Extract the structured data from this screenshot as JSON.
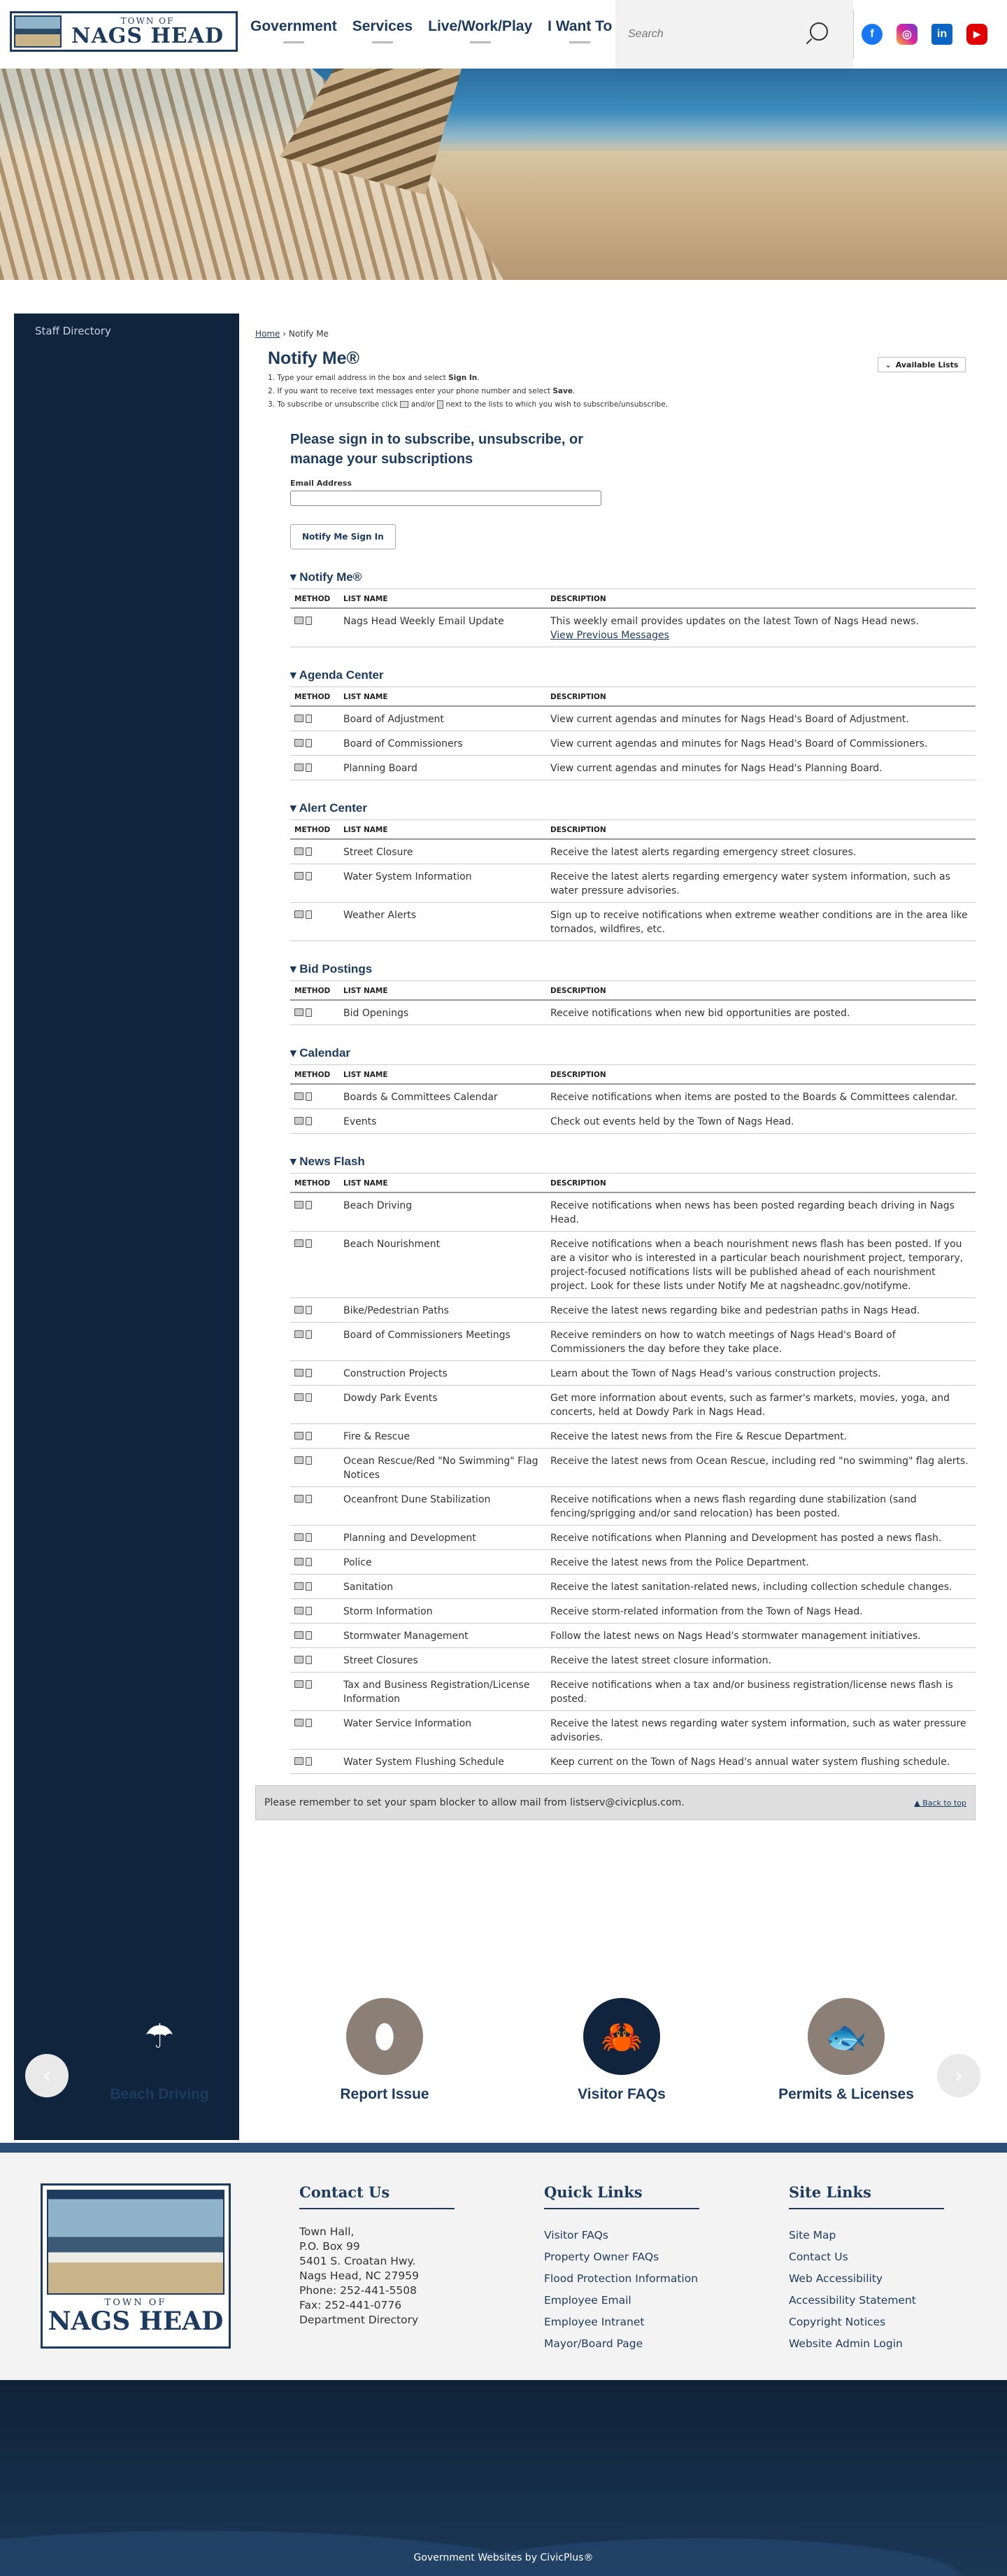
{
  "header": {
    "logo": {
      "top": "TOWN OF",
      "name": "NAGS HEAD"
    },
    "nav": [
      "Government",
      "Services",
      "Live/Work/Play",
      "I Want To"
    ],
    "search": {
      "placeholder": "Search",
      "value": ""
    },
    "social": [
      {
        "name": "facebook",
        "glyph": "f",
        "color": "#1877f2"
      },
      {
        "name": "instagram",
        "glyph": "◎",
        "color": "#d6249f"
      },
      {
        "name": "linkedin",
        "glyph": "in",
        "color": "#0a66c2"
      },
      {
        "name": "youtube",
        "glyph": "▶",
        "color": "#e00000"
      }
    ]
  },
  "sidebar": {
    "items": [
      "Staff Directory"
    ]
  },
  "breadcrumb": {
    "home": "Home",
    "sep": "›",
    "current": "Notify Me"
  },
  "page": {
    "title": "Notify Me®",
    "available_lists": "Available Lists",
    "instructions": [
      "1. Type your email address in the box and select ",
      "Sign In",
      "2. If you want to receive text messages enter your phone number and select ",
      "Save",
      "3. To subscribe or unsubscribe click ",
      " and/or ",
      " next to the lists to which you wish to subscribe/unsubscribe."
    ]
  },
  "signin": {
    "heading": "Please sign in to subscribe, unsubscribe, or manage your subscriptions",
    "email_label": "Email Address",
    "email_value": "",
    "button": "Notify Me Sign In"
  },
  "table_headers": {
    "method": "METHOD",
    "list": "LIST NAME",
    "desc": "DESCRIPTION"
  },
  "sections": [
    {
      "title": "Notify Me®",
      "rows": [
        {
          "name": "Nags Head Weekly Email Update",
          "desc": "This weekly email provides updates on the latest Town of Nags Head news.",
          "link": "View Previous Messages"
        }
      ]
    },
    {
      "title": "Agenda Center",
      "rows": [
        {
          "name": "Board of Adjustment",
          "desc": "View current agendas and minutes for Nags Head's Board of Adjustment."
        },
        {
          "name": "Board of Commissioners",
          "desc": "View current agendas and minutes for Nags Head's Board of Commissioners."
        },
        {
          "name": "Planning Board",
          "desc": "View current agendas and minutes for Nags Head's Planning Board."
        }
      ]
    },
    {
      "title": "Alert Center",
      "rows": [
        {
          "name": "Street Closure",
          "desc": "Receive the latest alerts regarding emergency street closures."
        },
        {
          "name": "Water System Information",
          "desc": "Receive the latest alerts regarding emergency water system information, such as water pressure advisories."
        },
        {
          "name": "Weather Alerts",
          "desc": "Sign up to receive notifications when extreme weather conditions are in the area like tornados, wildfires, etc."
        }
      ]
    },
    {
      "title": "Bid Postings",
      "rows": [
        {
          "name": "Bid Openings",
          "desc": "Receive notifications when new bid opportunities are posted."
        }
      ]
    },
    {
      "title": "Calendar",
      "rows": [
        {
          "name": "Boards & Committees Calendar",
          "desc": "Receive notifications when items are posted to the Boards & Committees calendar."
        },
        {
          "name": "Events",
          "desc": "Check out events held by the Town of Nags Head."
        }
      ]
    },
    {
      "title": "News Flash",
      "rows": [
        {
          "name": "Beach Driving",
          "desc": "Receive notifications when news has been posted regarding beach driving in Nags Head."
        },
        {
          "name": "Beach Nourishment",
          "desc": "Receive notifications when a beach nourishment news flash has been posted. If you are a visitor who is interested in a particular beach nourishment project, temporary, project-focused notifications lists will be published ahead of each nourishment project. Look for these lists under Notify Me at nagsheadnc.gov/notifyme."
        },
        {
          "name": "Bike/Pedestrian Paths",
          "desc": "Receive the latest news regarding bike and pedestrian paths in Nags Head."
        },
        {
          "name": "Board of Commissioners Meetings",
          "desc": "Receive reminders on how to watch meetings of Nags Head's Board of Commissioners the day before they take place."
        },
        {
          "name": "Construction Projects",
          "desc": "Learn about the Town of Nags Head's various construction projects."
        },
        {
          "name": "Dowdy Park Events",
          "desc": "Get more information about events, such as farmer's markets, movies, yoga, and concerts, held at Dowdy Park in Nags Head."
        },
        {
          "name": "Fire & Rescue",
          "desc": "Receive the latest news from the Fire & Rescue Department."
        },
        {
          "name": "Ocean Rescue/Red \"No Swimming\" Flag Notices",
          "desc": "Receive the latest news from Ocean Rescue, including red \"no swimming\" flag alerts."
        },
        {
          "name": "Oceanfront Dune Stabilization",
          "desc": "Receive notifications when a news flash regarding dune stabilization (sand fencing/sprigging and/or sand relocation) has been posted."
        },
        {
          "name": "Planning and Development",
          "desc": "Receive notifications when Planning and Development has posted a news flash."
        },
        {
          "name": "Police",
          "desc": "Receive the latest news from the Police Department."
        },
        {
          "name": "Sanitation",
          "desc": "Receive the latest sanitation-related news, including collection schedule changes."
        },
        {
          "name": "Storm Information",
          "desc": "Receive storm-related information from the Town of Nags Head."
        },
        {
          "name": "Stormwater Management",
          "desc": "Follow the latest news on Nags Head's stormwater management initiatives."
        },
        {
          "name": "Street Closures",
          "desc": "Receive the latest street closure information."
        },
        {
          "name": "Tax and Business Registration/License Information",
          "desc": "Receive notifications when a tax and/or business registration/license news flash is posted."
        },
        {
          "name": "Water Service Information",
          "desc": "Receive the latest news regarding water system information, such as water pressure advisories."
        },
        {
          "name": "Water System Flushing Schedule",
          "desc": "Keep current on the Town of Nags Head's annual water system flushing schedule."
        }
      ]
    }
  ],
  "spam_notice": "Please remember to set your spam blocker to allow mail from listserv@civicplus.com.",
  "back_to_top": "▲ Back to top",
  "tiles": [
    {
      "label": "Beach Driving",
      "icon": "☂",
      "color": "#10253d"
    },
    {
      "label": "Report Issue",
      "icon": "⬮",
      "color": "#8c7f76"
    },
    {
      "label": "Visitor FAQs",
      "icon": "🦀",
      "color": "#10253d"
    },
    {
      "label": "Permits & Licenses",
      "icon": "🐟",
      "color": "#8c7f76"
    }
  ],
  "footer": {
    "logo": {
      "top": "TOWN OF",
      "name": "NAGS HEAD"
    },
    "contact": {
      "title": "Contact Us",
      "lines": [
        "Town Hall,",
        "P.O. Box 99",
        "5401 S. Croatan Hwy.",
        "Nags Head, NC 27959",
        "Phone: 252-441-5508",
        "Fax: 252-441-0776",
        "Department Directory"
      ]
    },
    "quick_links": {
      "title": "Quick Links",
      "items": [
        "Visitor FAQs",
        "Property Owner FAQs",
        "Flood Protection Information",
        "Employee Email",
        "Employee Intranet",
        "Mayor/Board Page"
      ]
    },
    "site_links": {
      "title": "Site Links",
      "items": [
        "Site Map",
        "Contact Us",
        "Web Accessibility",
        "Accessibility Statement",
        "Copyright Notices",
        "Website Admin Login"
      ]
    },
    "powered": "Government Websites by CivicPlus®"
  }
}
